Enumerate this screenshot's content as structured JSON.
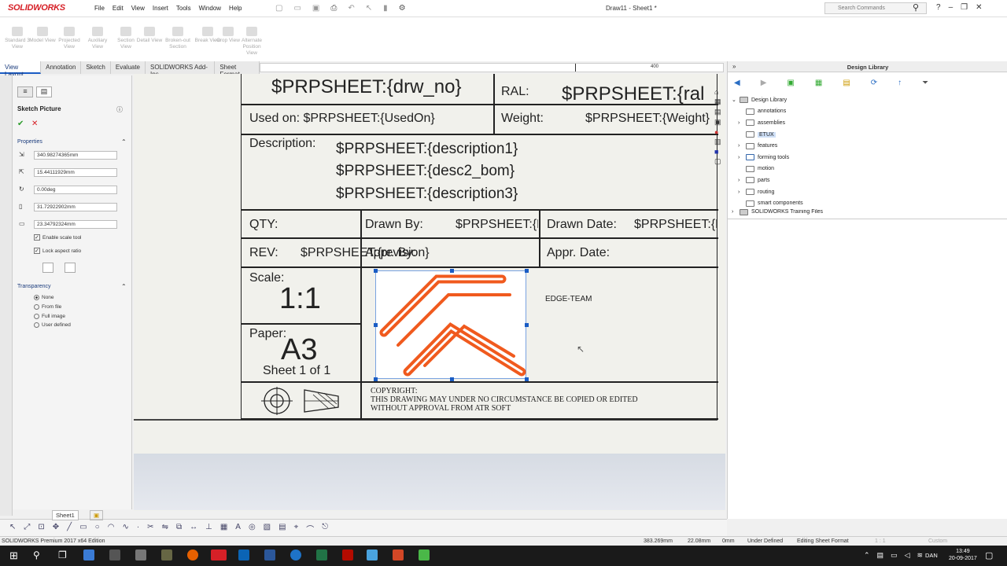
{
  "app": {
    "brand": "SOLIDWORKS",
    "doc_title": "Draw11 - Sheet1 *",
    "search_placeholder": "Search Commands"
  },
  "menu": [
    "File",
    "Edit",
    "View",
    "Insert",
    "Tools",
    "Window",
    "Help"
  ],
  "toolbar": [
    "Standard 3 View",
    "Model View",
    "Projected View",
    "Auxiliary View",
    "Section View",
    "Detail View",
    "Broken-out Section",
    "Break View",
    "Crop View",
    "Alternate Position View"
  ],
  "tabs": [
    "View Layout",
    "Annotation",
    "Sketch",
    "Evaluate",
    "SOLIDWORKS Add-Ins",
    "Sheet Format"
  ],
  "scroll_value": "400",
  "sketch_picture": {
    "title": "Sketch Picture",
    "properties_label": "Properties",
    "fields": [
      "340.98274365mm",
      "15.44111929mm",
      "0.00deg",
      "31.72922902mm",
      "23.34792324mm"
    ],
    "enable_scale": "Enable scale tool",
    "lock_aspect": "Lock aspect ratio",
    "transparency_label": "Transparency",
    "transparency_options": [
      "None",
      "From file",
      "Full image",
      "User defined"
    ]
  },
  "title_block": {
    "drw_no": "$PRPSHEET:{drw_no}",
    "ral_label": "RAL:",
    "ral_value": "$PRPSHEET:{ral",
    "used_on": "Used on: $PRPSHEET:{UsedOn}",
    "weight_label": "Weight:",
    "weight_value": "$PRPSHEET:{Weight}",
    "desc_label": "Description:",
    "desc1": "$PRPSHEET:{description1}",
    "desc2": "$PRPSHEET:{desc2_bom}",
    "desc3": "$PRPSHEET:{description3}",
    "qty_label": "QTY:",
    "drawn_by_label": "Drawn By:",
    "drawn_by_value": "$PRPSHEET:{DrawnBy}",
    "drawn_date_label": "Drawn Date:",
    "drawn_date_value": "$PRPSHEET:{D",
    "rev_label": "REV:",
    "rev_value": "$PRPSHEET:{revision}",
    "appr_by_label": "Appr. By:",
    "appr_date_label": "Appr. Date:",
    "scale_label": "Scale:",
    "scale_value": "1:1",
    "paper_label": "Paper:",
    "paper_value": "A3",
    "sheet_of": "Sheet 1 of 1",
    "company": "EDGE-TEAM",
    "copyright_title": "COPYRIGHT:",
    "copyright_line1": "THIS DRAWING MAY UNDER NO CIRCUMSTANCE BE COPIED OR EDITED",
    "copyright_line2": "WITHOUT APPROVAL FROM ATR SOFT"
  },
  "design_library": {
    "title": "Design Library",
    "root": "Design Library",
    "items": [
      "annotations",
      "assemblies",
      "ETUX",
      "features",
      "forming tools",
      "motion",
      "parts",
      "routing",
      "smart components"
    ],
    "training": "SOLIDWORKS Training Files"
  },
  "sheet_tab": "Sheet1",
  "status": {
    "edition": "SOLIDWORKS Premium 2017 x64 Edition",
    "x": "383.269mm",
    "y": "22.08mm",
    "z": "0mm",
    "state": "Under Defined",
    "mode": "Editing Sheet Format",
    "scale": "1 : 1",
    "units": "Custom"
  },
  "clock": {
    "time": "13:49",
    "date": "20-09-2017",
    "lang": "DAN"
  },
  "colors": {
    "logo_orange": "#f05a1e",
    "brand_red": "#d62027",
    "accent_blue": "#1a5cc4"
  }
}
